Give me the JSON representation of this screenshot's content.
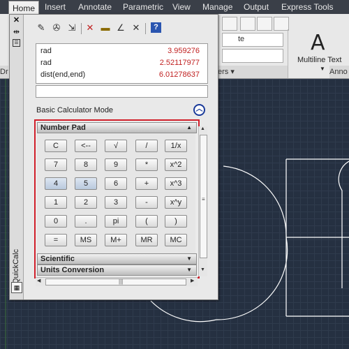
{
  "menubar": {
    "tabs": [
      "Home",
      "Insert",
      "Annotate",
      "Parametric",
      "View",
      "Manage",
      "Output",
      "Express Tools"
    ]
  },
  "ribbon": {
    "multiline_text_label": "Multiline Text",
    "multiline_glyph": "A",
    "panel_labels": [
      "Dr",
      "ers ▾",
      "Anno"
    ],
    "combo_text": "te"
  },
  "palette": {
    "title": "QuickCalc",
    "toolbar_icons": [
      "clear-icon",
      "clear-history-icon",
      "paste-value-icon",
      "get-coordinates-icon",
      "distance-icon",
      "angle-icon",
      "intersection-icon",
      "help-icon"
    ],
    "history": [
      {
        "expr": "rad",
        "value": "3.959276"
      },
      {
        "expr": "rad",
        "value": "2.52117977"
      },
      {
        "expr": "dist(end,end)",
        "value": "6.01278637"
      }
    ],
    "input_value": "",
    "mode_label": "Basic Calculator Mode",
    "sections": {
      "number_pad": "Number Pad",
      "scientific": "Scientific",
      "units_conversion": "Units Conversion"
    },
    "keys": [
      [
        "C",
        "<--",
        "√",
        "/",
        "1/x"
      ],
      [
        "7",
        "8",
        "9",
        "*",
        "x^2"
      ],
      [
        "4",
        "5",
        "6",
        "+",
        "x^3"
      ],
      [
        "1",
        "2",
        "3",
        "-",
        "x^y"
      ],
      [
        "0",
        ".",
        "pi",
        "(",
        ")"
      ],
      [
        "=",
        "MS",
        "M+",
        "MR",
        "MC"
      ]
    ]
  },
  "colors": {
    "frame_highlight": "#d01f2a",
    "value_text": "#c02020",
    "canvas": "#253041"
  }
}
